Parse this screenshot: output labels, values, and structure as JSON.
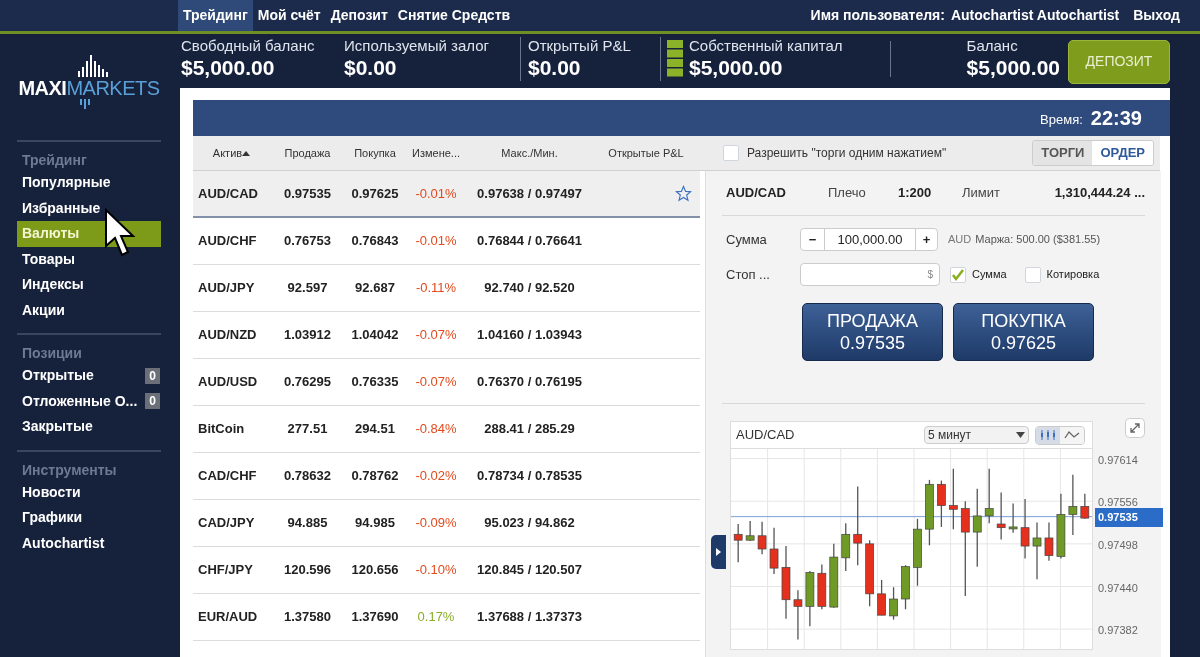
{
  "top_nav": {
    "tabs": [
      {
        "label": "Трейдинг",
        "selected": true
      },
      {
        "label": "Мой счёт",
        "selected": false
      },
      {
        "label": "Депозит",
        "selected": false
      },
      {
        "label": "Снятие Средств",
        "selected": false
      }
    ],
    "user_label": "Имя пользователя:",
    "user_name": "Autochartist Autochartist",
    "logout": "Выход"
  },
  "logo": {
    "part1": "MAXI",
    "part2": "MARKETS"
  },
  "account": {
    "stats": [
      {
        "label": "Свободный баланс",
        "value": "$5,000.00",
        "kind": "plain"
      },
      {
        "label": "Используемый залог",
        "value": "$0.00",
        "kind": "plain"
      },
      {
        "label": "Открытый P&L",
        "value": "$0.00",
        "kind": "plain"
      },
      {
        "label": "Собственный капитал",
        "value": "$5,000.00",
        "kind": "meter"
      }
    ],
    "balance": {
      "label": "Баланс",
      "value": "$5,000.00"
    },
    "deposit_button": "ДЕПОЗИТ"
  },
  "sidebar": {
    "sections": [
      {
        "title": "Трейдинг",
        "items": [
          {
            "label": "Популярные",
            "selected": false
          },
          {
            "label": "Избранные",
            "selected": false
          },
          {
            "label": "Валюты",
            "selected": true
          },
          {
            "label": "Товары",
            "selected": false
          },
          {
            "label": "Индексы",
            "selected": false
          },
          {
            "label": "Акции",
            "selected": false
          }
        ]
      },
      {
        "title": "Позиции",
        "items": [
          {
            "label": "Открытые",
            "count": "0",
            "selected": false
          },
          {
            "label": "Отложенные О...",
            "count": "0",
            "selected": false
          },
          {
            "label": "Закрытые",
            "selected": false
          }
        ]
      },
      {
        "title": "Инструменты",
        "items": [
          {
            "label": "Новости",
            "selected": false
          },
          {
            "label": "Графики",
            "selected": false
          },
          {
            "label": "Autochartist",
            "selected": false
          }
        ]
      }
    ]
  },
  "time": {
    "label": "Время:",
    "value": "22:39"
  },
  "table": {
    "columns": [
      {
        "label": "Актив",
        "sorted": true
      },
      {
        "label": "Продажа",
        "sorted": false
      },
      {
        "label": "Покупка",
        "sorted": false
      },
      {
        "label": "Измене...",
        "sorted": false
      },
      {
        "label": "Макс./Мин.",
        "sorted": false
      },
      {
        "label": "Открытые P&L",
        "sorted": false
      }
    ],
    "rows": [
      {
        "asset": "AUD/CAD",
        "sell": "0.97535",
        "buy": "0.97625",
        "change": "-0.01%",
        "color": "#e24a1c",
        "range": "0.97638 / 0.97497",
        "selected": true
      },
      {
        "asset": "AUD/CHF",
        "sell": "0.76753",
        "buy": "0.76843",
        "change": "-0.01%",
        "color": "#e24a1c",
        "range": "0.76844 / 0.76641",
        "selected": false
      },
      {
        "asset": "AUD/JPY",
        "sell": "92.597",
        "buy": "92.687",
        "change": "-0.11%",
        "color": "#e24a1c",
        "range": "92.740 / 92.520",
        "selected": false
      },
      {
        "asset": "AUD/NZD",
        "sell": "1.03912",
        "buy": "1.04042",
        "change": "-0.07%",
        "color": "#e24a1c",
        "range": "1.04160 / 1.03943",
        "selected": false
      },
      {
        "asset": "AUD/USD",
        "sell": "0.76295",
        "buy": "0.76335",
        "change": "-0.07%",
        "color": "#e24a1c",
        "range": "0.76370 / 0.76195",
        "selected": false
      },
      {
        "asset": "BitCoin",
        "sell": "277.51",
        "buy": "294.51",
        "change": "-0.84%",
        "color": "#e24a1c",
        "range": "288.41 / 285.29",
        "selected": false
      },
      {
        "asset": "CAD/CHF",
        "sell": "0.78632",
        "buy": "0.78762",
        "change": "-0.02%",
        "color": "#e24a1c",
        "range": "0.78734 / 0.78535",
        "selected": false
      },
      {
        "asset": "CAD/JPY",
        "sell": "94.885",
        "buy": "94.985",
        "change": "-0.09%",
        "color": "#e24a1c",
        "range": "95.023 / 94.862",
        "selected": false
      },
      {
        "asset": "CHF/JPY",
        "sell": "120.596",
        "buy": "120.656",
        "change": "-0.10%",
        "color": "#e24a1c",
        "range": "120.845 / 120.507",
        "selected": false
      },
      {
        "asset": "EUR/AUD",
        "sell": "1.37580",
        "buy": "1.37690",
        "change": "0.17%",
        "color": "#8aad2a",
        "range": "1.37688 / 1.37373",
        "selected": false
      }
    ]
  },
  "one_click": {
    "label": "Разрешить \"торги одним нажатием\"",
    "checked": false
  },
  "mode_tabs": [
    {
      "label": "ТОРГИ",
      "selected": false
    },
    {
      "label": "ОРДЕР",
      "selected": true
    }
  ],
  "order": {
    "asset": "AUD/CAD",
    "leverage_label": "Плечо",
    "leverage": "1:200",
    "limit_label": "Лимит",
    "limit": "1,310,444.24 ...",
    "amount_label": "Сумма",
    "minus": "−",
    "amount": "100,000.00",
    "plus": "+",
    "currency": "AUD",
    "margin": "Маржа: 500.00 ($381.55)",
    "stop_label": "Стоп ...",
    "stop_unit": "$",
    "stop_options": [
      {
        "label": "Сумма",
        "checked": true
      },
      {
        "label": "Котировка",
        "checked": false
      }
    ],
    "sell": {
      "label": "ПРОДАЖА",
      "price": "0.97535"
    },
    "buy": {
      "label": "ПОКУПКА",
      "price": "0.97625"
    }
  },
  "chart": {
    "symbol": "AUD/CAD",
    "interval": "5 минут",
    "views": [
      {
        "kind": "candles",
        "selected": true
      },
      {
        "kind": "line",
        "selected": false
      }
    ],
    "chart_data": {
      "type": "candlestick",
      "grid": true,
      "ref_lines": [
        {
          "axis": "y",
          "value": 0.97535,
          "label": "0.97535",
          "color": "#7d9fd6"
        }
      ],
      "ohlc": [
        [
          0.97511,
          0.97525,
          0.97473,
          0.97503
        ],
        [
          0.97503,
          0.97529,
          0.97502,
          0.97509
        ],
        [
          0.97509,
          0.97528,
          0.97484,
          0.97491
        ],
        [
          0.97491,
          0.9752,
          0.97457,
          0.97465
        ],
        [
          0.97466,
          0.97495,
          0.97396,
          0.97422
        ],
        [
          0.97422,
          0.97435,
          0.97368,
          0.97413
        ],
        [
          0.97413,
          0.97461,
          0.97386,
          0.97459
        ],
        [
          0.97458,
          0.9747,
          0.97409,
          0.97413
        ],
        [
          0.97412,
          0.97498,
          0.97411,
          0.9748
        ],
        [
          0.97479,
          0.97526,
          0.97461,
          0.97511
        ],
        [
          0.97511,
          0.97576,
          0.97469,
          0.97499
        ],
        [
          0.97498,
          0.97503,
          0.97413,
          0.9743
        ],
        [
          0.9743,
          0.97449,
          0.97401,
          0.97401
        ],
        [
          0.974,
          0.97439,
          0.97395,
          0.97423
        ],
        [
          0.97423,
          0.97469,
          0.97409,
          0.97467
        ],
        [
          0.97466,
          0.97532,
          0.97441,
          0.97518
        ],
        [
          0.97518,
          0.97585,
          0.97496,
          0.97579
        ],
        [
          0.97579,
          0.97584,
          0.97521,
          0.9755
        ],
        [
          0.9755,
          0.976,
          0.97518,
          0.97545
        ],
        [
          0.97546,
          0.97556,
          0.97427,
          0.97514
        ],
        [
          0.97514,
          0.97573,
          0.97467,
          0.97536
        ],
        [
          0.97536,
          0.976,
          0.97526,
          0.97546
        ],
        [
          0.97525,
          0.97568,
          0.97504,
          0.9752
        ],
        [
          0.97519,
          0.97553,
          0.97513,
          0.97521
        ],
        [
          0.9752,
          0.97559,
          0.97478,
          0.97495
        ],
        [
          0.97495,
          0.97527,
          0.9745,
          0.97506
        ],
        [
          0.97506,
          0.97527,
          0.97475,
          0.97482
        ],
        [
          0.97481,
          0.97566,
          0.97478,
          0.97538
        ],
        [
          0.97538,
          0.97592,
          0.9751,
          0.97549
        ],
        [
          0.97549,
          0.97566,
          0.97532,
          0.97533
        ]
      ],
      "ylim": [
        0.97355,
        0.97627
      ],
      "yticks": [
        {
          "value": 0.97614,
          "label": "0.97614"
        },
        {
          "value": 0.97556,
          "label": "0.97556"
        },
        {
          "value": 0.97498,
          "label": "0.97498"
        },
        {
          "value": 0.9744,
          "label": "0.97440"
        },
        {
          "value": 0.97382,
          "label": "0.97382"
        }
      ]
    }
  }
}
